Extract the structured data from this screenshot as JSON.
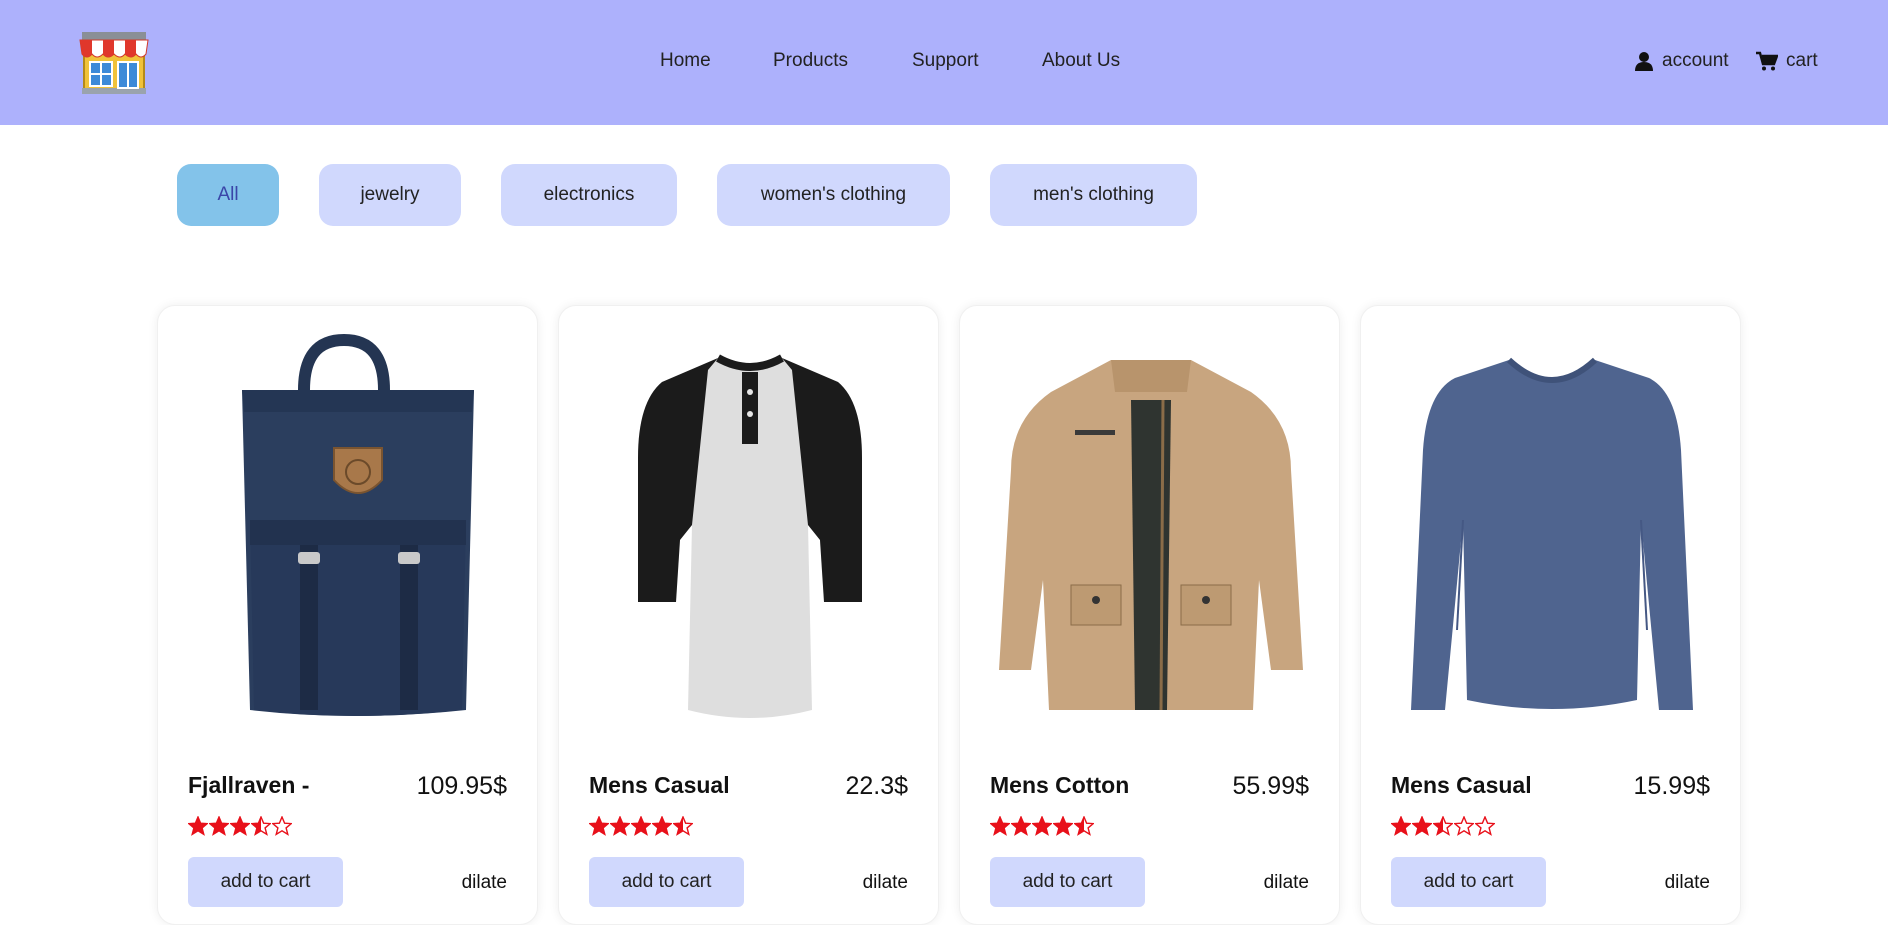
{
  "header": {
    "logo_icon": "storefront-icon",
    "nav": [
      "Home",
      "Products",
      "Support",
      "About Us"
    ],
    "account_label": "account",
    "account_icon": "user-icon",
    "cart_label": "cart",
    "cart_icon": "cart-icon"
  },
  "filters": {
    "items": [
      "All",
      "jewelry",
      "electronics",
      "women's clothing",
      "men's clothing"
    ],
    "active": "All"
  },
  "products": [
    {
      "title": "Fjallraven -",
      "price": "109.95$",
      "rating": 3.5,
      "add_label": "add to cart",
      "details_label": "dilate",
      "image_icon": "backpack-image"
    },
    {
      "title": "Mens Casual",
      "price": "22.3$",
      "rating": 4.5,
      "add_label": "add to cart",
      "details_label": "dilate",
      "image_icon": "raglan-tshirt-image"
    },
    {
      "title": "Mens Cotton",
      "price": "55.99$",
      "rating": 4.5,
      "add_label": "add to cart",
      "details_label": "dilate",
      "image_icon": "cotton-jacket-image"
    },
    {
      "title": "Mens Casual",
      "price": "15.99$",
      "rating": 2.5,
      "add_label": "add to cart",
      "details_label": "dilate",
      "image_icon": "longsleeve-shirt-image"
    }
  ],
  "colors": {
    "header_bg": "#adb1fc",
    "chip_bg": "#d0d8fd",
    "chip_active_bg": "#83c3ea",
    "star": "#e8101a"
  }
}
